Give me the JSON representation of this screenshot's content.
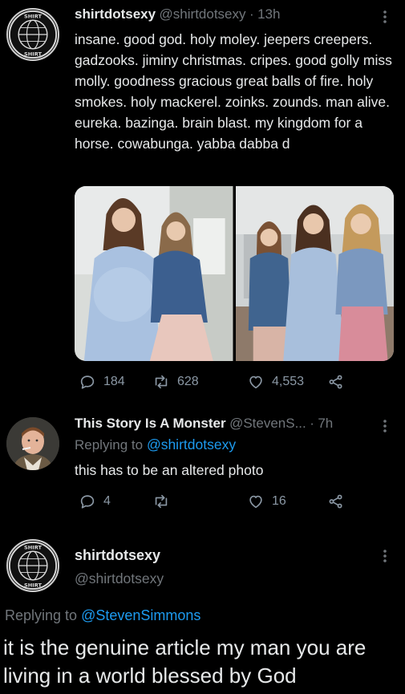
{
  "tweet1": {
    "display_name": "shirtdotsexy",
    "handle": "@shirtdotsexy",
    "separator": "·",
    "time": "13h",
    "text": "insane. good god. holy moley. jeepers creepers. gadzooks. jiminy christmas. cripes. good golly miss molly. goodness gracious great balls of fire.  holy smokes. holy mackerel. zoinks. zounds. man alive. eureka. bazinga. brain blast. my kingdom for a horse. cowabunga. yabba dabba d",
    "replies": "184",
    "retweets": "628",
    "likes": "4,553"
  },
  "tweet2": {
    "display_name": "This Story Is A Monster",
    "handle": "@StevenS...",
    "separator": "·",
    "time": "7h",
    "replying_prefix": "Replying to",
    "replying_to": "@shirtdotsexy",
    "text": "this has to be an altered photo",
    "replies": "4",
    "retweets": "",
    "likes": "16"
  },
  "tweet3": {
    "display_name": "shirtdotsexy",
    "handle": "@shirtdotsexy",
    "replying_prefix": "Replying to",
    "replying_to": "@StevenSimmons",
    "text": "it is the genuine article my man you are living in a world blessed by God"
  },
  "colors": {
    "background": "#000000",
    "text": "#e7e9ea",
    "muted": "#71767b",
    "link": "#1d9bf0"
  },
  "icons": [
    "reply-icon",
    "retweet-icon",
    "like-icon",
    "share-icon",
    "more-icon"
  ]
}
